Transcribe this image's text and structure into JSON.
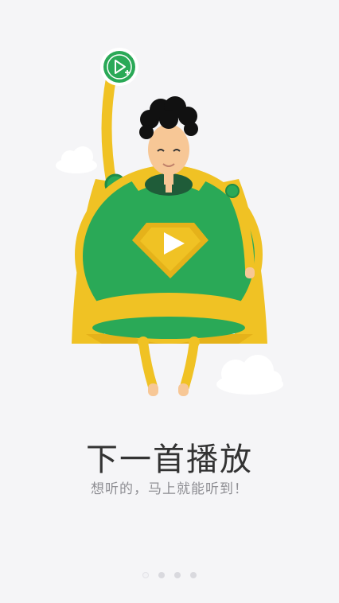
{
  "onboarding": {
    "title": "下一首播放",
    "subtitle": "想听的，马上就能听到！",
    "page_indicator": {
      "total": 4,
      "active_index": 0
    }
  },
  "colors": {
    "background": "#f5f5f7",
    "hero_green": "#2aa957",
    "cape_yellow": "#f0c224",
    "skin": "#f7c796"
  },
  "icons": {
    "badge": "play-next-icon",
    "emblem": "play-icon"
  }
}
